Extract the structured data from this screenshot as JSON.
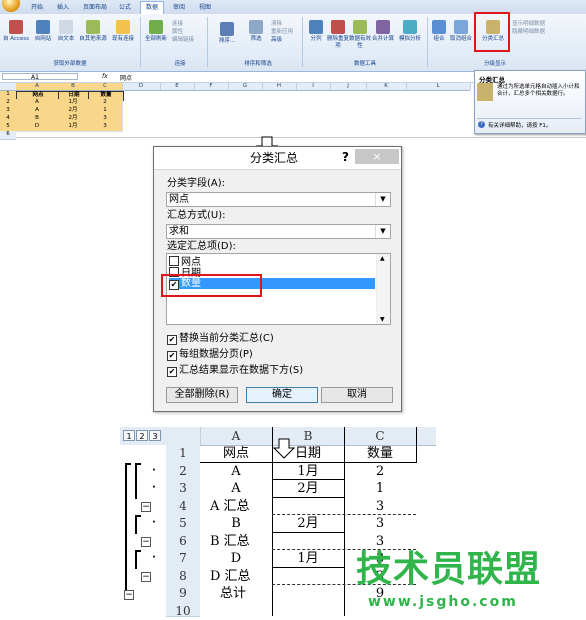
{
  "ribbon": {
    "tabs": [
      "开始",
      "插入",
      "页面布局",
      "公式",
      "数据",
      "审阅",
      "视图"
    ],
    "active_tab": "数据",
    "buttons": [
      "自 Access",
      "自网站",
      "自文本",
      "自其他来源",
      "现有连接",
      "全部刷新",
      "排序...",
      "筛选",
      "分列",
      "删除重复项",
      "数据有效性",
      "合并计算",
      "模拟分析",
      "组合",
      "取消组合",
      "分类汇总"
    ],
    "small_items": [
      "连接",
      "属性",
      "编辑链接",
      "清除",
      "重新应用",
      "高级",
      "显示明细数据",
      "隐藏明细数据"
    ],
    "groups": [
      "获取外部数据",
      "连接",
      "排序和筛选",
      "数据工具",
      "分级显示"
    ]
  },
  "formula_bar": {
    "cell": "A1",
    "fx": "fx",
    "value": "网点"
  },
  "top_sheet": {
    "columns": [
      "A",
      "B",
      "C",
      "D",
      "E",
      "F",
      "G",
      "H",
      "I",
      "J",
      "K",
      "L"
    ],
    "rows": [
      "1",
      "2",
      "3",
      "4",
      "5",
      "6"
    ],
    "header": [
      "网点",
      "日期",
      "数量"
    ],
    "data": [
      [
        "A",
        "1月",
        "2"
      ],
      [
        "A",
        "2月",
        "1"
      ],
      [
        "B",
        "2月",
        "3"
      ],
      [
        "D",
        "1月",
        "3"
      ]
    ]
  },
  "tooltip": {
    "title": "分类汇总",
    "body": "通过为所选单元格自动插入小计和合计，汇总多个相关数据行。",
    "help": "有关详细帮助，请按 F1。"
  },
  "dialog": {
    "title": "分类汇总",
    "help": "?",
    "close": "×",
    "field_label": "分类字段(A):",
    "field_value": "网点",
    "method_label": "汇总方式(U):",
    "method_value": "求和",
    "items_label": "选定汇总项(D):",
    "items": [
      {
        "label": "网点",
        "checked": false
      },
      {
        "label": "日期",
        "checked": false
      },
      {
        "label": "数量",
        "checked": true
      }
    ],
    "options": [
      {
        "label": "替换当前分类汇总(C)",
        "checked": true
      },
      {
        "label": "每组数据分页(P)",
        "checked": true
      },
      {
        "label": "汇总结果显示在数据下方(S)",
        "checked": true
      }
    ],
    "remove_all": "全部删除(R)",
    "ok": "确定",
    "cancel": "取消"
  },
  "bottom_sheet": {
    "levels": [
      "1",
      "2",
      "3"
    ],
    "columns": [
      "A",
      "B",
      "C"
    ],
    "rows": [
      "1",
      "2",
      "3",
      "4",
      "5",
      "6",
      "7",
      "8",
      "9",
      "10"
    ],
    "cells": [
      [
        "网点",
        "日期",
        "数量"
      ],
      [
        "A",
        "1月",
        "2"
      ],
      [
        "A",
        "2月",
        "1"
      ],
      [
        "A 汇总",
        "",
        "3"
      ],
      [
        "B",
        "2月",
        "3"
      ],
      [
        "B 汇总",
        "",
        "3"
      ],
      [
        "D",
        "1月",
        "3"
      ],
      [
        "D 汇总",
        "",
        "3"
      ],
      [
        "总计",
        "",
        "9"
      ],
      [
        "",
        "",
        ""
      ]
    ]
  },
  "watermark": {
    "text": "技术员联盟",
    "url": "www.jsgho.com"
  }
}
